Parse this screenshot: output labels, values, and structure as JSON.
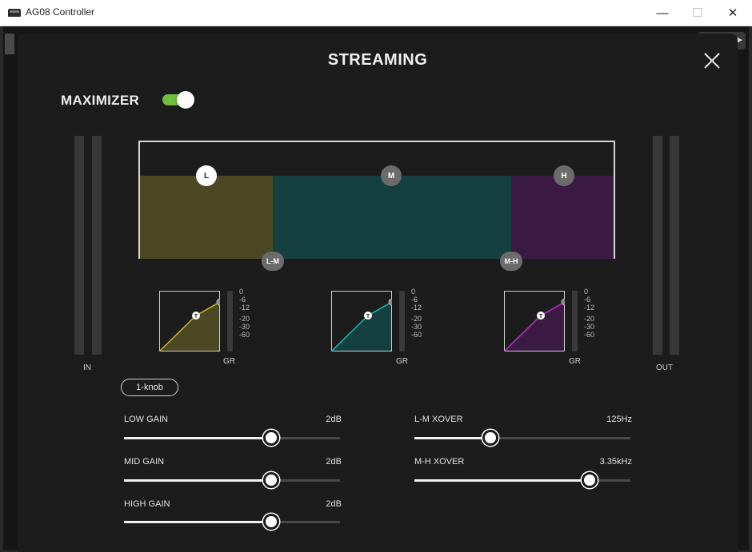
{
  "window": {
    "title": "AG08 Controller",
    "minimize_glyph": "—",
    "maximize_glyph": "☐",
    "close_glyph": "✕"
  },
  "modal": {
    "title": "STREAMING",
    "maximizer_label": "MAXIMIZER",
    "maximizer_on": true,
    "toggle_color": "#6fbf3c"
  },
  "meters": {
    "in_label": "IN",
    "out_label": "OUT"
  },
  "bands": {
    "low_handle": "L",
    "mid_handle": "M",
    "high_handle": "H",
    "lm_handle": "L-M",
    "mh_handle": "M-H",
    "low_color": "#4b4823",
    "mid_color": "#14413f",
    "high_color": "#3b1b43"
  },
  "compressors": {
    "scale": [
      "0",
      "-6",
      "-12",
      "-20",
      "-30",
      "-60"
    ],
    "gr_label": "GR",
    "threshold_marker": "T",
    "low_color": "#c9b92c",
    "mid_color": "#21b9b6",
    "high_color": "#c02ec9"
  },
  "knob_button": "1-knob",
  "sliders": {
    "low_gain": {
      "label": "LOW GAIN",
      "value": "2dB",
      "level": 0.68
    },
    "mid_gain": {
      "label": "MID GAIN",
      "value": "2dB",
      "level": 0.68
    },
    "high_gain": {
      "label": "HIGH GAIN",
      "value": "2dB",
      "level": 0.68
    },
    "lm_xover": {
      "label": "L-M XOVER",
      "value": "125Hz",
      "level": 0.35
    },
    "mh_xover": {
      "label": "M-H XOVER",
      "value": "3.35kHz",
      "level": 0.81
    }
  }
}
